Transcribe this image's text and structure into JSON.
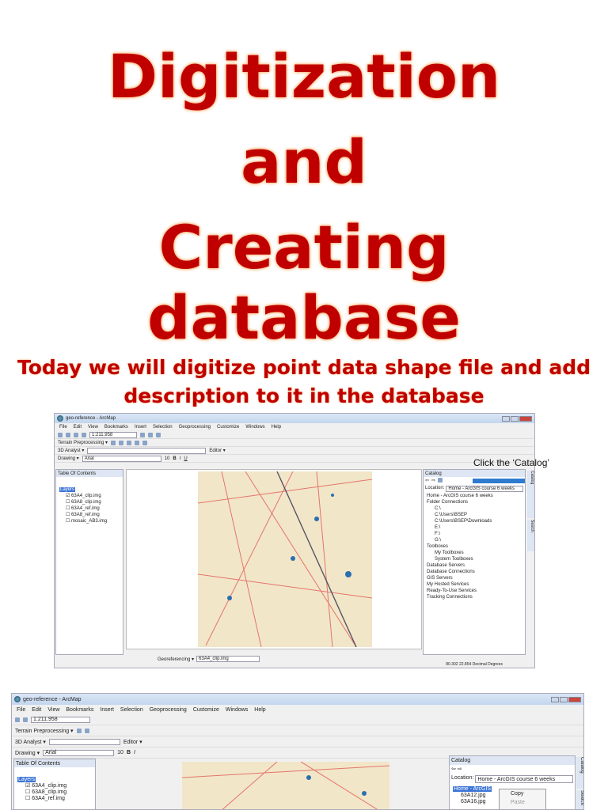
{
  "slide": {
    "title_lines": [
      "Digitization",
      "and",
      "Creating database"
    ],
    "subtitle_lines": [
      "Today we will digitize point data shape file and add",
      "description to it in the database"
    ],
    "callout": "Click the ‘Catalog’"
  },
  "arcmap": {
    "window_title": "geo-reference - ArcMap",
    "menu": [
      "File",
      "Edit",
      "View",
      "Bookmarks",
      "Insert",
      "Selection",
      "Geoprocessing",
      "Customize",
      "Windows",
      "Help"
    ],
    "scale": "1:211.958",
    "toolbars": {
      "terrain": "Terrain Preprocessing ▾",
      "analyst": "3D Analyst ▾",
      "editor": "Editor ▾",
      "drawing": "Drawing ▾",
      "font": "Arial",
      "font_size": "10",
      "georef": "Georeferencing ▾",
      "georef_layer": "63A4_clip.img"
    },
    "toc": {
      "title": "Table Of Contents",
      "root": "Layers",
      "layers": [
        {
          "name": "63A4_clip.img",
          "checked": true
        },
        {
          "name": "63A8_clip.img",
          "checked": false
        },
        {
          "name": "63A4_ref.img",
          "checked": false
        },
        {
          "name": "63A8_ref.img",
          "checked": false
        },
        {
          "name": "mosaic_AB3.img",
          "checked": false
        }
      ]
    },
    "catalog": {
      "title": "Catalog",
      "location_label": "Location:",
      "location": "Home - ArcGIS course 6 weeks",
      "tree": [
        "Home - ArcGIS course 6 weeks",
        "Folder Connections",
        "C:\\",
        "C:\\Users\\BSEP",
        "C:\\Users\\BSEP\\Downloads",
        "E:\\",
        "F:\\",
        "G:\\",
        "Toolboxes",
        "My Toolboxes",
        "System Toolboxes",
        "Database Servers",
        "Database Connections",
        "GIS Servers",
        "My Hosted Services",
        "Ready-To-Use Services",
        "Tracking Connections"
      ],
      "side_tabs": [
        "Catalog",
        "Search"
      ]
    },
    "status": "80.302  22.854 Decimal Degrees",
    "second": {
      "catalog_root": "Home - ArcGIS",
      "files": [
        "63A12.jpg",
        "63A16.jpg"
      ],
      "context_menu": [
        "Copy",
        "Paste"
      ]
    }
  }
}
